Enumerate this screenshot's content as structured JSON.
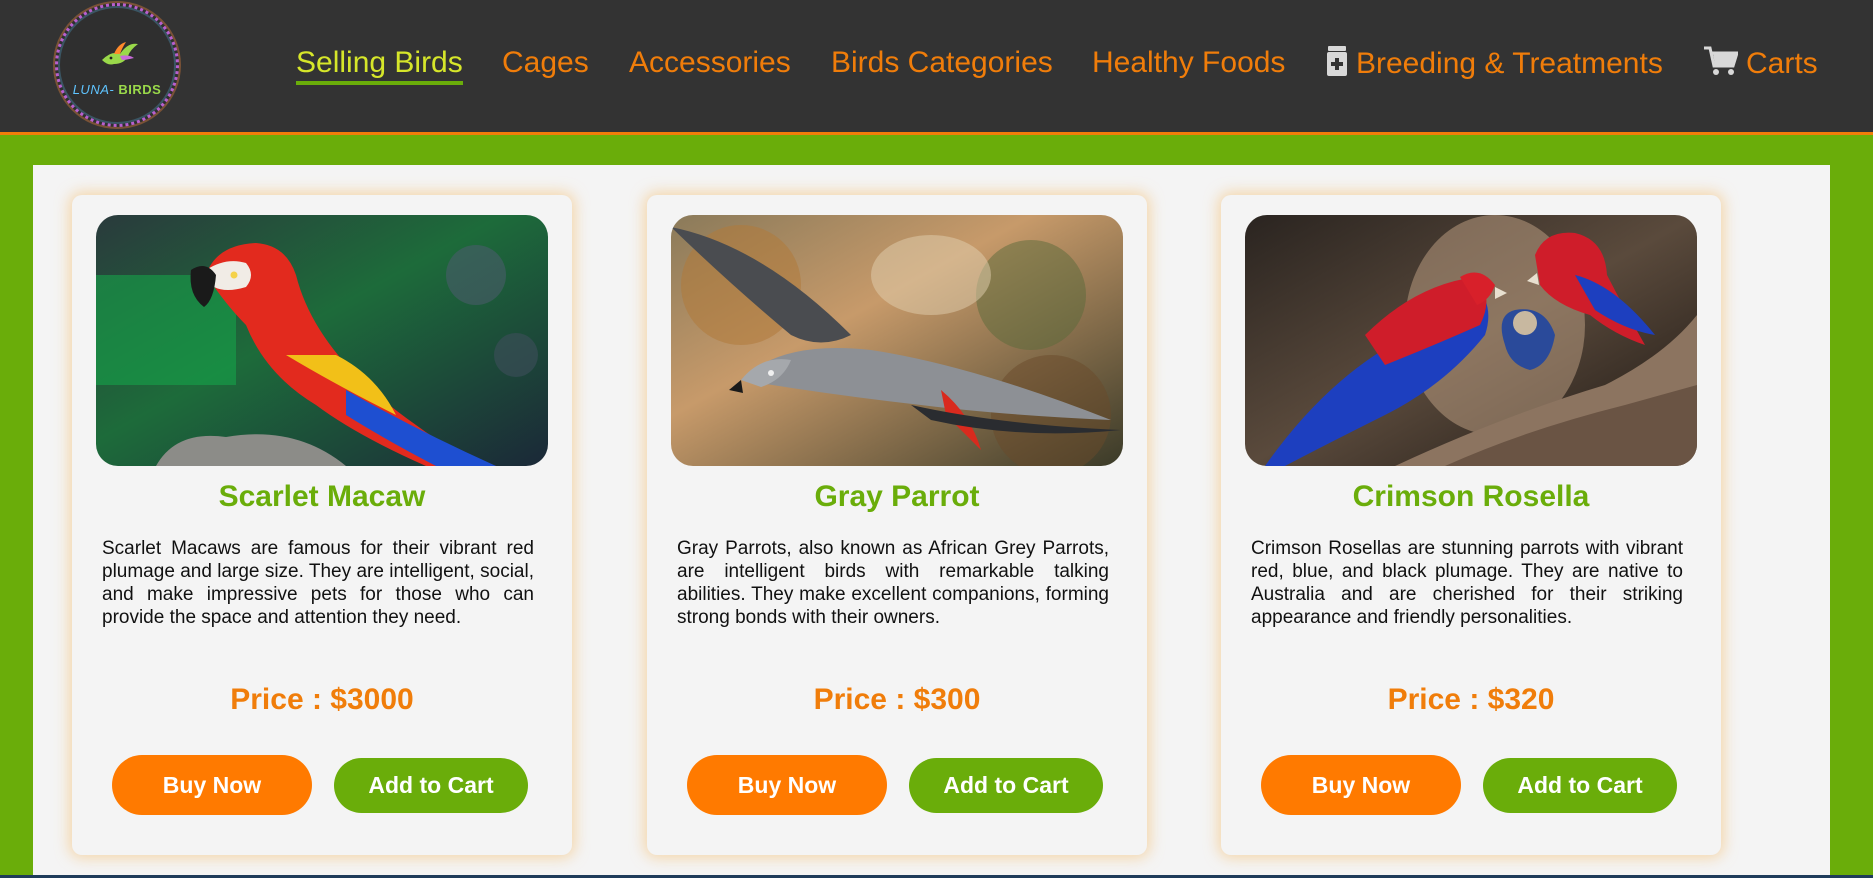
{
  "header": {
    "logo_text_left": "LUNA-",
    "logo_text_right": "BIRDS",
    "nav": [
      {
        "label": "Selling Birds",
        "active": true,
        "icon": ""
      },
      {
        "label": "Cages",
        "active": false,
        "icon": ""
      },
      {
        "label": "Accessories",
        "active": false,
        "icon": ""
      },
      {
        "label": "Birds Categories",
        "active": false,
        "icon": ""
      },
      {
        "label": "Healthy Foods",
        "active": false,
        "icon": ""
      },
      {
        "label": "Breeding & Treatments",
        "active": false,
        "icon": "medicine-bottle-icon"
      },
      {
        "label": "Carts",
        "active": false,
        "icon": "shopping-cart-icon"
      }
    ]
  },
  "products": [
    {
      "name": "Scarlet Macaw",
      "description": "Scarlet Macaws are famous for their vibrant red plumage and large size. They are intelligent, social, and make impressive pets for those who can provide the space and attention they need.",
      "price": "Price : $3000",
      "buy_label": "Buy Now",
      "cart_label": "Add to Cart"
    },
    {
      "name": "Gray Parrot",
      "description": "Gray Parrots, also known as African Grey Parrots, are intelligent birds with remarkable talking abilities. They make excellent companions, forming strong bonds with their owners.",
      "price": "Price : $300",
      "buy_label": "Buy Now",
      "cart_label": "Add to Cart"
    },
    {
      "name": "Crimson Rosella",
      "description": "Crimson Rosellas are stunning parrots with vibrant red, blue, and black plumage. They are native to Australia and are cherished for their striking appearance and friendly personalities.",
      "price": "Price : $320",
      "buy_label": "Buy Now",
      "cart_label": "Add to Cart"
    }
  ],
  "colors": {
    "accent_orange": "#f07d0a",
    "accent_green": "#6aad0a",
    "active_nav": "#d6e62a",
    "header_bg": "#333333"
  }
}
